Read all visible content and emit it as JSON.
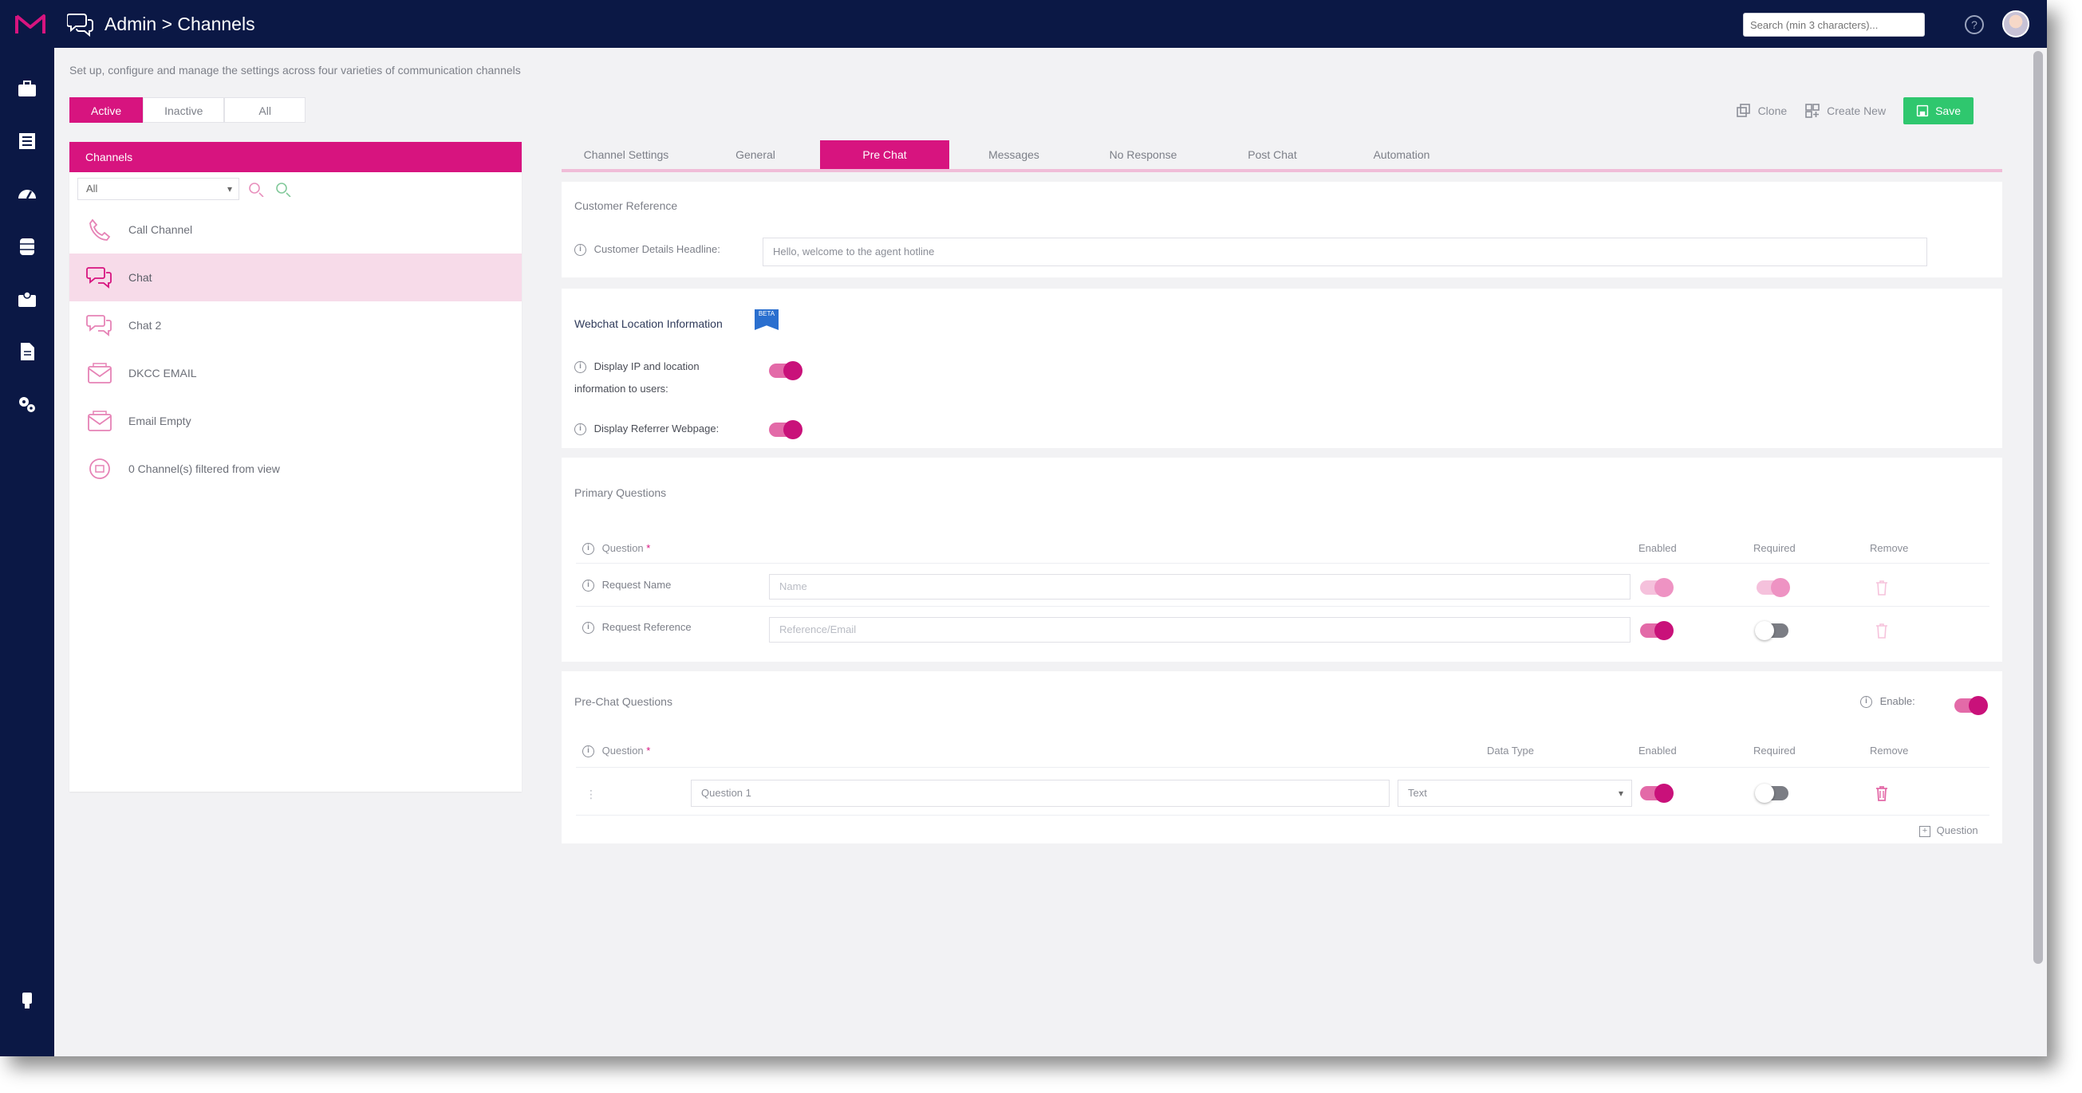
{
  "app": {
    "title": "Admin > Channels",
    "search_placeholder": "Search (min 3 characters)..."
  },
  "page": {
    "intro": "Set up, configure and manage the settings across four varieties of communication channels",
    "filters": [
      "Active",
      "Inactive",
      "All"
    ],
    "actions": {
      "clone": "Clone",
      "create_new": "Create New",
      "save": "Save"
    }
  },
  "channels": {
    "header": "Channels",
    "filter_value": "All",
    "items": [
      {
        "label": "Call Channel",
        "icon": "phone-icon"
      },
      {
        "label": "Chat",
        "icon": "chat-icon",
        "selected": true
      },
      {
        "label": "Chat 2",
        "icon": "chat-icon"
      },
      {
        "label": "DKCC EMAIL",
        "icon": "email-icon"
      },
      {
        "label": "Email Empty",
        "icon": "email-icon"
      },
      {
        "label": "0 Channel(s) filtered from view",
        "icon": "filter-icon"
      }
    ]
  },
  "tabs": [
    "Channel Settings",
    "General",
    "Pre Chat",
    "Messages",
    "No Response",
    "Post Chat",
    "Automation"
  ],
  "active_tab": "Pre Chat",
  "customer_reference": {
    "title": "Customer Reference",
    "label": "Customer Details Headline:",
    "value": "Hello, welcome to the agent hotline"
  },
  "webchat_location": {
    "title": "Webchat Location Information",
    "badge": "BETA",
    "display_ip_label_1": "Display IP and location",
    "display_ip_label_2": "information to users:",
    "display_ip_on": true,
    "referrer_label": "Display Referrer Webpage:",
    "referrer_on": true
  },
  "primary_questions": {
    "title": "Primary Questions",
    "headers": {
      "question": "Question",
      "required_mark": "*",
      "enabled": "Enabled",
      "required": "Required",
      "remove": "Remove"
    },
    "rows": [
      {
        "label": "Request Name",
        "placeholder": "Name",
        "enabled": true,
        "required": true,
        "locked": true
      },
      {
        "label": "Request Reference",
        "placeholder": "Reference/Email",
        "enabled": true,
        "required": false,
        "locked": false
      }
    ]
  },
  "prechat_questions": {
    "title": "Pre-Chat Questions",
    "enable_label": "Enable:",
    "enabled": true,
    "headers": {
      "question": "Question",
      "required_mark": "*",
      "data_type": "Data Type",
      "enabled": "Enabled",
      "required": "Required",
      "remove": "Remove"
    },
    "rows": [
      {
        "value": "Question 1",
        "data_type": "Text",
        "enabled": true,
        "required": false
      }
    ],
    "add_label": "Question"
  },
  "colors": {
    "topbar": "#0b1845",
    "accent": "#d7147f",
    "selected_row": "#f7dbe9",
    "save": "#2fc76e"
  }
}
